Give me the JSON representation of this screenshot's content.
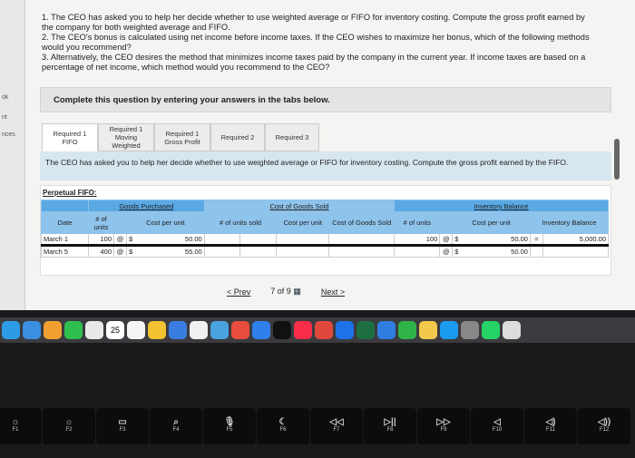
{
  "sidebar_fragments": [
    "ok",
    "nt",
    "nces"
  ],
  "question": {
    "items": [
      "1. The CEO has asked you to help her decide whether to use weighted average or FIFO for inventory costing. Compute the gross profit earned by the company for both weighted average and FIFO.",
      "2. The CEO's bonus is calculated using net income before income taxes. If the CEO wishes to maximize her bonus, which of the following methods would you recommend?",
      "3. Alternatively, the CEO desires the method that minimizes income taxes paid by the company in the current year. If income taxes are based on a percentage of net income, which method would you recommend to the CEO?"
    ]
  },
  "instructions": "Complete this question by entering your answers in the tabs below.",
  "tabs": [
    "Required 1 FIFO",
    "Required 1 Moving Weighted",
    "Required 1 Gross Profit",
    "Required 2",
    "Required 3"
  ],
  "active_tab": 0,
  "info": "The CEO has asked you to help her decide whether to use weighted average or FIFO for inventory costing. Compute the gross profit earned by the FIFO.",
  "table": {
    "title": "Perpetual FIFO:",
    "groups": [
      "Goods Purchased",
      "Cost of Goods Sold",
      "Inventory Balance"
    ],
    "headers": [
      "Date",
      "# of units",
      "Cost per unit",
      "# of units sold",
      "Cost per unit",
      "Cost of Goods Sold",
      "# of units",
      "Cost per unit",
      "Inventory Balance"
    ],
    "rows": [
      {
        "date": "March 1",
        "gp_units": "100",
        "at": "@",
        "dollar": "$",
        "gp_cost": "50.00",
        "ib_units": "100",
        "ib_cost": "50.00",
        "eq": "=",
        "ib_total": "5,000.00"
      },
      {
        "date": "March 5",
        "gp_units": "400",
        "at": "@",
        "dollar": "$",
        "gp_cost": "55.00",
        "ib_units": "",
        "ib_cost": "50.00",
        "eq": "",
        "ib_total": ""
      }
    ]
  },
  "pager": {
    "prev": "< Prev",
    "position": "7 of 9",
    "next": "Next >"
  },
  "dock_colors": [
    "#2e9be6",
    "#3b8fe0",
    "#f0a030",
    "#2fbf4f",
    "#e9e9e9",
    "#ff9500",
    "#f5f5f5",
    "#f2c230",
    "#3a7de0",
    "#f0f0f0",
    "#4aa3df",
    "#e74c3c",
    "#2f80ed",
    "#111",
    "#fa2d48",
    "#e0483e",
    "#1e73e8",
    "#1d6f42",
    "#2f7de1",
    "#30b44a",
    "#f2c94c",
    "#1a9bf0",
    "#888",
    "#25d366",
    "#ddd"
  ],
  "dock_badge": "25",
  "keys": [
    {
      "label": "F1",
      "icon": "☼"
    },
    {
      "label": "F2",
      "icon": "☼"
    },
    {
      "label": "F3",
      "icon": "▭"
    },
    {
      "label": "F4",
      "icon": "⌕"
    },
    {
      "label": "F5",
      "icon": "🎙"
    },
    {
      "label": "F6",
      "icon": "☾"
    },
    {
      "label": "F7",
      "icon": "◁◁"
    },
    {
      "label": "F8",
      "icon": "▷||"
    },
    {
      "label": "F9",
      "icon": "▷▷"
    },
    {
      "label": "F10",
      "icon": "◁"
    },
    {
      "label": "F11",
      "icon": "◁)"
    },
    {
      "label": "F12",
      "icon": "◁))"
    }
  ]
}
